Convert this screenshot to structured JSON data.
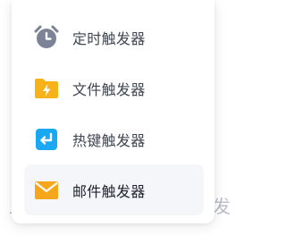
{
  "background": {
    "left_char": "上",
    "right_char": "发"
  },
  "menu": {
    "items": [
      {
        "label": "定时触发器",
        "icon": "alarm-clock-icon",
        "color": "#7c8396",
        "active": false
      },
      {
        "label": "文件触发器",
        "icon": "folder-lightning-icon",
        "color": "#f7b21a",
        "active": false
      },
      {
        "label": "热键触发器",
        "icon": "hotkey-enter-icon",
        "color": "#1aa8f2",
        "active": false
      },
      {
        "label": "邮件触发器",
        "icon": "envelope-icon",
        "color": "#f7a51a",
        "active": true
      }
    ]
  }
}
